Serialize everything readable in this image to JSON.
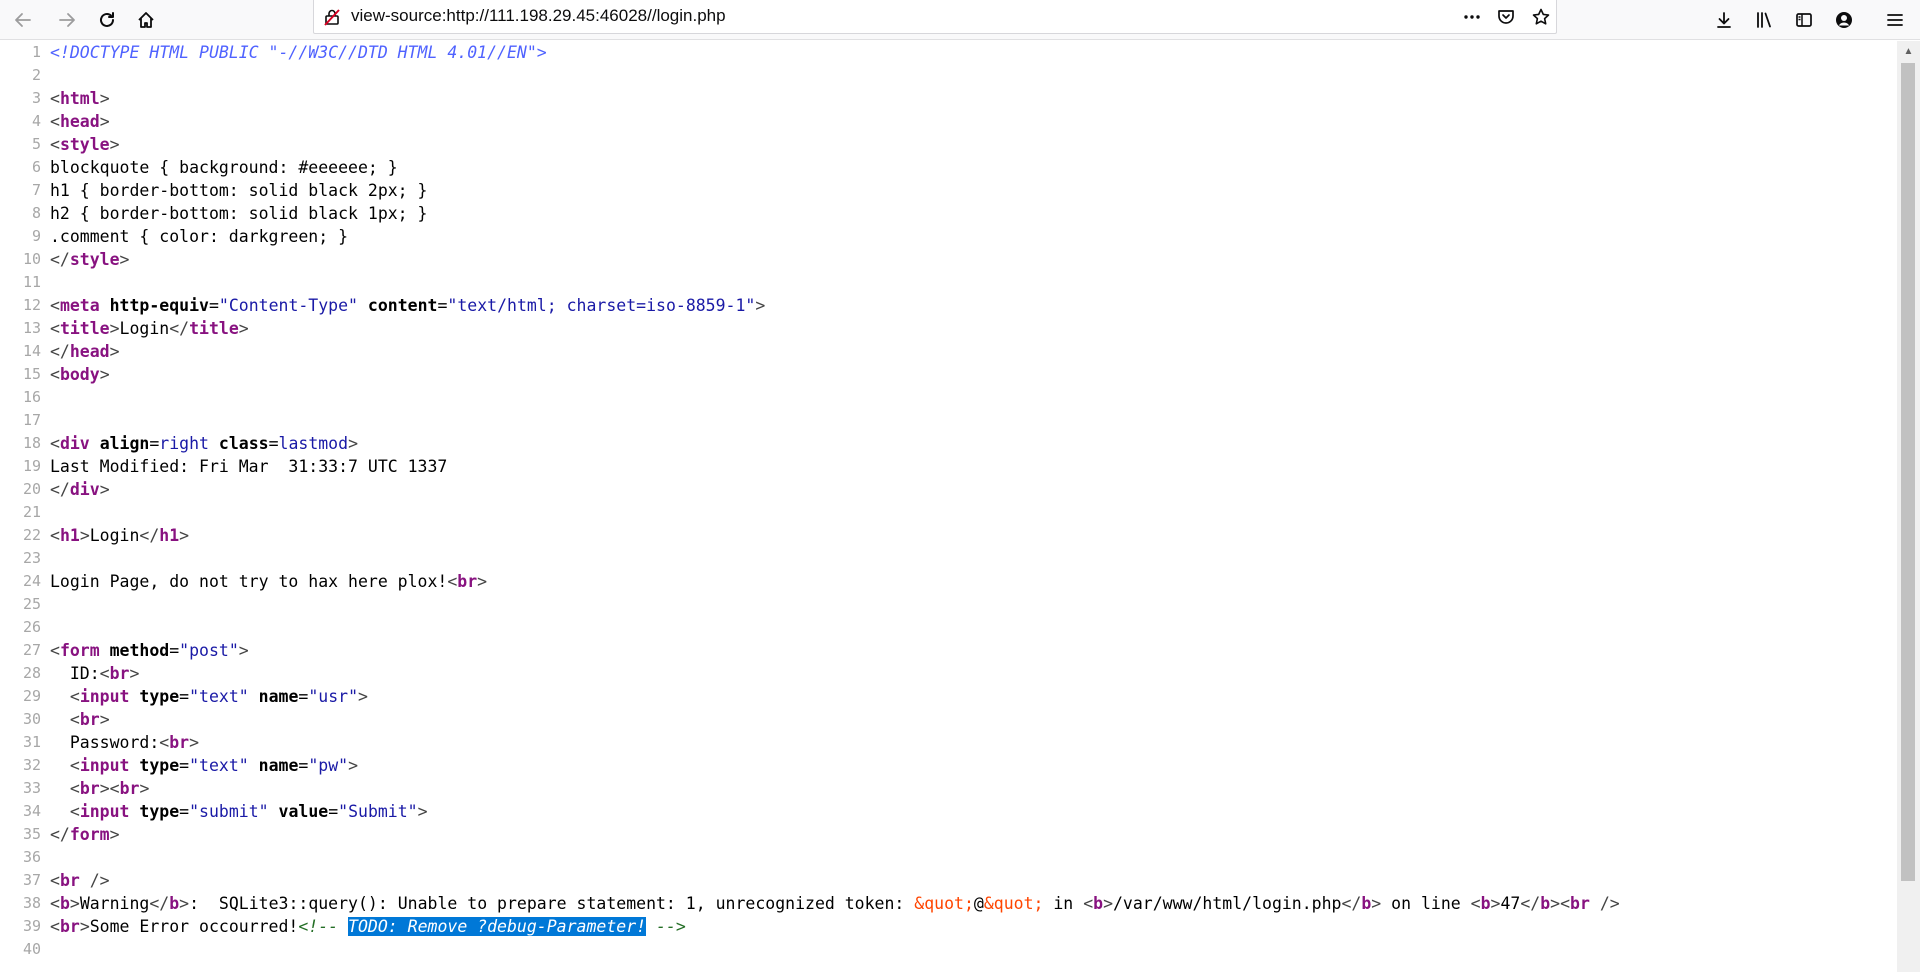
{
  "toolbar": {
    "url": "view-source:http://111.198.29.45:46028//login.php",
    "icons": [
      "back-arrow-icon",
      "forward-arrow-icon",
      "reload-icon",
      "home-icon",
      "insecure-lock-icon",
      "more-dots-icon",
      "pocket-icon",
      "star-icon",
      "download-icon",
      "library-icon",
      "sidebar-icon",
      "account-icon",
      "menu-icon"
    ]
  },
  "source": {
    "lines": [
      {
        "n": "1",
        "y": 0,
        "tokens": [
          {
            "t": "<!DOCTYPE HTML PUBLIC \"-//W3C//DTD HTML 4.01//EN\">",
            "c": "doctype"
          }
        ]
      },
      {
        "n": "2",
        "y": 1,
        "tokens": []
      },
      {
        "n": "3",
        "y": 2,
        "tokens": [
          {
            "t": "<",
            "c": "br"
          },
          {
            "t": "html",
            "c": "tag"
          },
          {
            "t": ">",
            "c": "br"
          }
        ]
      },
      {
        "n": "4",
        "y": 3,
        "tokens": [
          {
            "t": "<",
            "c": "br"
          },
          {
            "t": "head",
            "c": "tag"
          },
          {
            "t": ">",
            "c": "br"
          }
        ]
      },
      {
        "n": "5",
        "y": 4,
        "tokens": [
          {
            "t": "<",
            "c": "br"
          },
          {
            "t": "style",
            "c": "tag"
          },
          {
            "t": ">",
            "c": "br"
          }
        ]
      },
      {
        "n": "6",
        "y": 5,
        "tokens": [
          {
            "t": "blockquote { background: #eeeeee; }",
            "c": ""
          }
        ]
      },
      {
        "n": "7",
        "y": 6,
        "tokens": [
          {
            "t": "h1 { border-bottom: solid black 2px; }",
            "c": ""
          }
        ]
      },
      {
        "n": "8",
        "y": 7,
        "tokens": [
          {
            "t": "h2 { border-bottom: solid black 1px; }",
            "c": ""
          }
        ]
      },
      {
        "n": "9",
        "y": 8,
        "tokens": [
          {
            "t": ".comment { color: darkgreen; }",
            "c": ""
          }
        ]
      },
      {
        "n": "10",
        "y": 9,
        "tokens": [
          {
            "t": "</",
            "c": "br"
          },
          {
            "t": "style",
            "c": "tag"
          },
          {
            "t": ">",
            "c": "br"
          }
        ]
      },
      {
        "n": "11",
        "y": 10,
        "tokens": []
      },
      {
        "n": "12",
        "y": 11,
        "tokens": [
          {
            "t": "<",
            "c": "br"
          },
          {
            "t": "meta",
            "c": "tag"
          },
          {
            "t": " ",
            "c": ""
          },
          {
            "t": "http-equiv",
            "c": "an"
          },
          {
            "t": "=",
            "c": ""
          },
          {
            "t": "\"Content-Type\"",
            "c": "av"
          },
          {
            "t": " ",
            "c": ""
          },
          {
            "t": "content",
            "c": "an"
          },
          {
            "t": "=",
            "c": ""
          },
          {
            "t": "\"text/html; charset=iso-8859-1\"",
            "c": "av"
          },
          {
            "t": ">",
            "c": "br"
          }
        ]
      },
      {
        "n": "13",
        "y": 12,
        "tokens": [
          {
            "t": "<",
            "c": "br"
          },
          {
            "t": "title",
            "c": "tag"
          },
          {
            "t": ">",
            "c": "br"
          },
          {
            "t": "Login",
            "c": ""
          },
          {
            "t": "</",
            "c": "br"
          },
          {
            "t": "title",
            "c": "tag"
          },
          {
            "t": ">",
            "c": "br"
          }
        ]
      },
      {
        "n": "14",
        "y": 13,
        "tokens": [
          {
            "t": "</",
            "c": "br"
          },
          {
            "t": "head",
            "c": "tag"
          },
          {
            "t": ">",
            "c": "br"
          }
        ]
      },
      {
        "n": "15",
        "y": 14,
        "tokens": [
          {
            "t": "<",
            "c": "br"
          },
          {
            "t": "body",
            "c": "tag"
          },
          {
            "t": ">",
            "c": "br"
          }
        ]
      },
      {
        "n": "16",
        "y": 15,
        "tokens": []
      },
      {
        "n": "17",
        "y": 16,
        "tokens": []
      },
      {
        "n": "18",
        "y": 17,
        "tokens": [
          {
            "t": "<",
            "c": "br"
          },
          {
            "t": "div",
            "c": "tag"
          },
          {
            "t": " ",
            "c": ""
          },
          {
            "t": "align",
            "c": "an"
          },
          {
            "t": "=",
            "c": ""
          },
          {
            "t": "right",
            "c": "av"
          },
          {
            "t": " ",
            "c": ""
          },
          {
            "t": "class",
            "c": "an"
          },
          {
            "t": "=",
            "c": ""
          },
          {
            "t": "lastmod",
            "c": "av"
          },
          {
            "t": ">",
            "c": "br"
          }
        ]
      },
      {
        "n": "19",
        "y": 18,
        "tokens": [
          {
            "t": "Last Modified: Fri Mar  31:33:7 UTC 1337",
            "c": ""
          }
        ]
      },
      {
        "n": "20",
        "y": 19,
        "tokens": [
          {
            "t": "</",
            "c": "br"
          },
          {
            "t": "div",
            "c": "tag"
          },
          {
            "t": ">",
            "c": "br"
          }
        ]
      },
      {
        "n": "21",
        "y": 20,
        "tokens": []
      },
      {
        "n": "22",
        "y": 21,
        "tokens": [
          {
            "t": "<",
            "c": "br"
          },
          {
            "t": "h1",
            "c": "tag"
          },
          {
            "t": ">",
            "c": "br"
          },
          {
            "t": "Login",
            "c": ""
          },
          {
            "t": "</",
            "c": "br"
          },
          {
            "t": "h1",
            "c": "tag"
          },
          {
            "t": ">",
            "c": "br"
          }
        ]
      },
      {
        "n": "23",
        "y": 22,
        "tokens": []
      },
      {
        "n": "24",
        "y": 23,
        "tokens": [
          {
            "t": "Login Page, do not try to hax here plox!",
            "c": ""
          },
          {
            "t": "<",
            "c": "br"
          },
          {
            "t": "br",
            "c": "tag"
          },
          {
            "t": ">",
            "c": "br"
          }
        ]
      },
      {
        "n": "25",
        "y": 24,
        "tokens": []
      },
      {
        "n": "26",
        "y": 25,
        "tokens": []
      },
      {
        "n": "27",
        "y": 26,
        "tokens": [
          {
            "t": "<",
            "c": "br"
          },
          {
            "t": "form",
            "c": "tag"
          },
          {
            "t": " ",
            "c": ""
          },
          {
            "t": "method",
            "c": "an"
          },
          {
            "t": "=",
            "c": ""
          },
          {
            "t": "\"post\"",
            "c": "av"
          },
          {
            "t": ">",
            "c": "br"
          }
        ]
      },
      {
        "n": "28",
        "y": 27,
        "tokens": [
          {
            "t": "  ID:",
            "c": ""
          },
          {
            "t": "<",
            "c": "br"
          },
          {
            "t": "br",
            "c": "tag"
          },
          {
            "t": ">",
            "c": "br"
          }
        ]
      },
      {
        "n": "29",
        "y": 28,
        "tokens": [
          {
            "t": "  ",
            "c": ""
          },
          {
            "t": "<",
            "c": "br"
          },
          {
            "t": "input",
            "c": "tag"
          },
          {
            "t": " ",
            "c": ""
          },
          {
            "t": "type",
            "c": "an"
          },
          {
            "t": "=",
            "c": ""
          },
          {
            "t": "\"text\"",
            "c": "av"
          },
          {
            "t": " ",
            "c": ""
          },
          {
            "t": "name",
            "c": "an"
          },
          {
            "t": "=",
            "c": ""
          },
          {
            "t": "\"usr\"",
            "c": "av"
          },
          {
            "t": ">",
            "c": "br"
          }
        ]
      },
      {
        "n": "30",
        "y": 29,
        "tokens": [
          {
            "t": "  ",
            "c": ""
          },
          {
            "t": "<",
            "c": "br"
          },
          {
            "t": "br",
            "c": "tag"
          },
          {
            "t": ">",
            "c": "br"
          }
        ]
      },
      {
        "n": "31",
        "y": 30,
        "tokens": [
          {
            "t": "  Password:",
            "c": ""
          },
          {
            "t": "<",
            "c": "br"
          },
          {
            "t": "br",
            "c": "tag"
          },
          {
            "t": ">",
            "c": "br"
          }
        ]
      },
      {
        "n": "32",
        "y": 31,
        "tokens": [
          {
            "t": "  ",
            "c": ""
          },
          {
            "t": "<",
            "c": "br"
          },
          {
            "t": "input",
            "c": "tag"
          },
          {
            "t": " ",
            "c": ""
          },
          {
            "t": "type",
            "c": "an"
          },
          {
            "t": "=",
            "c": ""
          },
          {
            "t": "\"text\"",
            "c": "av"
          },
          {
            "t": " ",
            "c": ""
          },
          {
            "t": "name",
            "c": "an"
          },
          {
            "t": "=",
            "c": ""
          },
          {
            "t": "\"pw\"",
            "c": "av"
          },
          {
            "t": ">",
            "c": "br"
          }
        ]
      },
      {
        "n": "33",
        "y": 32,
        "tokens": [
          {
            "t": "  ",
            "c": ""
          },
          {
            "t": "<",
            "c": "br"
          },
          {
            "t": "br",
            "c": "tag"
          },
          {
            "t": "><",
            "c": "br"
          },
          {
            "t": "br",
            "c": "tag"
          },
          {
            "t": ">",
            "c": "br"
          }
        ]
      },
      {
        "n": "34",
        "y": 33,
        "tokens": [
          {
            "t": "  ",
            "c": ""
          },
          {
            "t": "<",
            "c": "br"
          },
          {
            "t": "input",
            "c": "tag"
          },
          {
            "t": " ",
            "c": ""
          },
          {
            "t": "type",
            "c": "an"
          },
          {
            "t": "=",
            "c": ""
          },
          {
            "t": "\"submit\"",
            "c": "av"
          },
          {
            "t": " ",
            "c": ""
          },
          {
            "t": "value",
            "c": "an"
          },
          {
            "t": "=",
            "c": ""
          },
          {
            "t": "\"Submit\"",
            "c": "av"
          },
          {
            "t": ">",
            "c": "br"
          }
        ]
      },
      {
        "n": "35",
        "y": 34,
        "tokens": [
          {
            "t": "</",
            "c": "br"
          },
          {
            "t": "form",
            "c": "tag"
          },
          {
            "t": ">",
            "c": "br"
          }
        ]
      },
      {
        "n": "36",
        "y": 35,
        "tokens": []
      },
      {
        "n": "37",
        "y": 36,
        "tokens": [
          {
            "t": "<",
            "c": "br"
          },
          {
            "t": "br",
            "c": "tag"
          },
          {
            "t": " />",
            "c": "br"
          }
        ]
      },
      {
        "n": "38",
        "y": 37,
        "tokens": [
          {
            "t": "<",
            "c": "br"
          },
          {
            "t": "b",
            "c": "tag"
          },
          {
            "t": ">",
            "c": "br"
          },
          {
            "t": "Warning",
            "c": ""
          },
          {
            "t": "</",
            "c": "br"
          },
          {
            "t": "b",
            "c": "tag"
          },
          {
            "t": ">",
            "c": "br"
          },
          {
            "t": ":  SQLite3::query(): Unable to prepare statement: 1, unrecognized token: ",
            "c": ""
          },
          {
            "t": "&quot;",
            "c": "ent"
          },
          {
            "t": "@",
            "c": ""
          },
          {
            "t": "&quot;",
            "c": "ent"
          },
          {
            "t": " in ",
            "c": ""
          },
          {
            "t": "<",
            "c": "br"
          },
          {
            "t": "b",
            "c": "tag"
          },
          {
            "t": ">",
            "c": "br"
          },
          {
            "t": "/var/www/html/login.php",
            "c": ""
          },
          {
            "t": "</",
            "c": "br"
          },
          {
            "t": "b",
            "c": "tag"
          },
          {
            "t": ">",
            "c": "br"
          },
          {
            "t": " on line ",
            "c": ""
          },
          {
            "t": "<",
            "c": "br"
          },
          {
            "t": "b",
            "c": "tag"
          },
          {
            "t": ">",
            "c": "br"
          },
          {
            "t": "47",
            "c": ""
          },
          {
            "t": "</",
            "c": "br"
          },
          {
            "t": "b",
            "c": "tag"
          },
          {
            "t": "><",
            "c": "br"
          },
          {
            "t": "br",
            "c": "tag"
          },
          {
            "t": " />",
            "c": "br"
          }
        ]
      },
      {
        "n": "39",
        "y": 38,
        "tokens": [
          {
            "t": "<",
            "c": "br"
          },
          {
            "t": "br",
            "c": "tag"
          },
          {
            "t": ">",
            "c": "br"
          },
          {
            "t": "Some Error occourred!",
            "c": ""
          },
          {
            "t": "<!-- ",
            "c": "cmt"
          },
          {
            "t": "TODO: Remove ?debug-Parameter!",
            "c": "cmt hl"
          },
          {
            "t": " -->",
            "c": "cmt"
          }
        ]
      },
      {
        "n": "40",
        "y": 39,
        "tokens": []
      }
    ]
  }
}
